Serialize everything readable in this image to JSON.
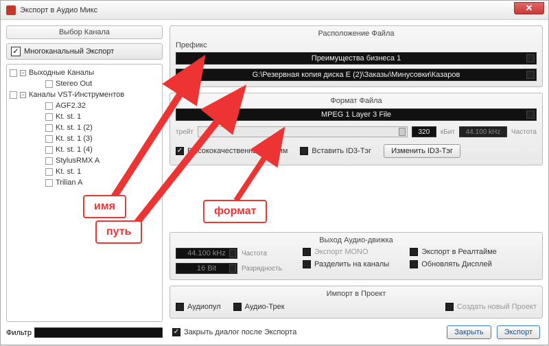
{
  "title": "Экспорт в Аудио Микс",
  "left": {
    "panel_title": "Выбор Канала",
    "multichannel_label": "Многоканальный Экспорт",
    "tree": {
      "group1": "Выходные Каналы",
      "g1_item1": "Stereo Out",
      "group2": "Каналы VST-Инструментов",
      "g2_items": [
        "AGF2.32",
        "Kt. st. 1",
        "Kt. st. 1 (2)",
        "Kt. st. 1 (3)",
        "Kt. st. 1 (4)",
        "StylusRMX A",
        "Kt. st. 1",
        "Trilian A"
      ]
    },
    "filter_label": "Фильтр"
  },
  "file_location": {
    "title": "Расположение Файла",
    "prefix_label": "Префикс",
    "prefix_value": "Преимущества бизнеса 1",
    "path_value": "G:\\Резервная копия диска E (2)\\Заказы\\Минусовки\\Казаров"
  },
  "format": {
    "title": "Формат Файла",
    "format_value": "MPEG 1 Layer 3 File",
    "bitrate_label": "трейт",
    "bitrate_value": "320",
    "kbit_label": "кБит",
    "freq_value": "44.100 kHz",
    "freq_label": "Частота",
    "hq_label": "Высококачественный Режим",
    "id3_insert_label": "Вставить ID3-Тэг",
    "id3_change_btn": "Изменить ID3-Тэг"
  },
  "engine": {
    "title": "Выход Аудио-движка",
    "freq_value": "44.100 kHz",
    "freq_label": "Частота",
    "depth_value": "16 Bit",
    "depth_label": "Разрядность",
    "mono_label": "Экспорт MONO",
    "realtime_label": "Экспорт в Реалтайме",
    "split_label": "Разделить на каналы",
    "refresh_label": "Обновлять Дисплей"
  },
  "project": {
    "title": "Импорт в Проект",
    "pool_label": "Аудиопул",
    "track_label": "Аудио-Трек",
    "newproj_label": "Создать новый Проект"
  },
  "footer": {
    "closeafter_label": "Закрыть диалог после Экспорта",
    "close_btn": "Закрыть",
    "export_btn": "Экспорт"
  },
  "annotations": {
    "name": "имя",
    "path": "путь",
    "format": "формат"
  }
}
